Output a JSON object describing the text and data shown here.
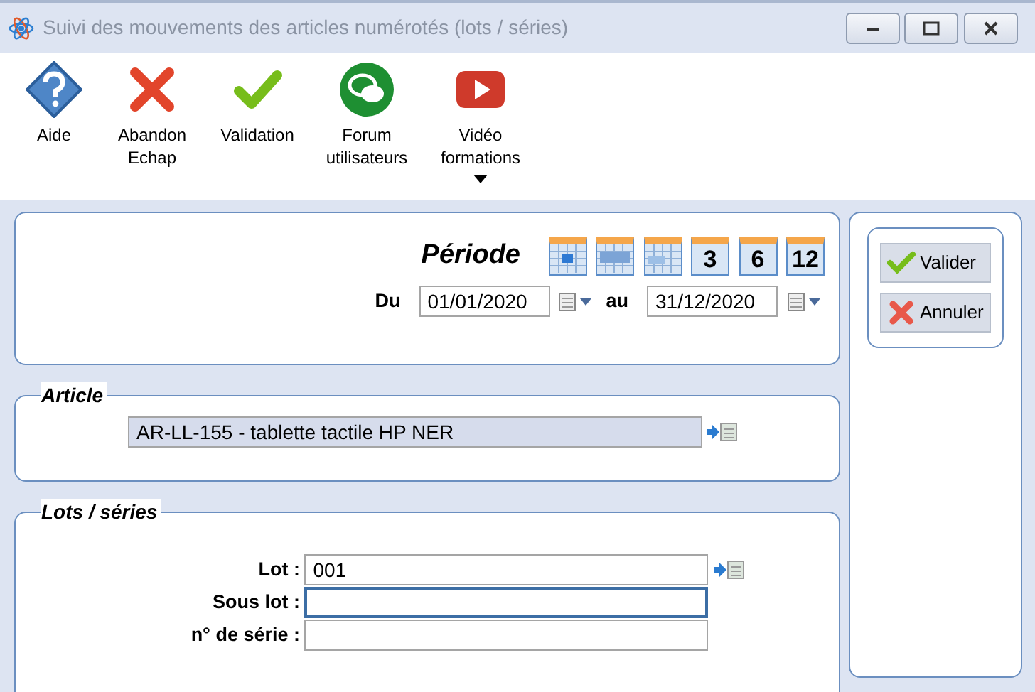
{
  "window": {
    "title": "Suivi des mouvements des articles numérotés (lots / séries)"
  },
  "toolbar": [
    {
      "kind": "help",
      "label": [
        "Aide"
      ],
      "has_menu": false
    },
    {
      "kind": "cancel",
      "label": [
        "Abandon",
        "Echap"
      ],
      "has_menu": false
    },
    {
      "kind": "ok",
      "label": [
        "Validation"
      ],
      "has_menu": false
    },
    {
      "kind": "forum",
      "label": [
        "Forum",
        "utilisateurs"
      ],
      "has_menu": false
    },
    {
      "kind": "video",
      "label": [
        "Vidéo",
        "formations"
      ],
      "has_menu": true
    }
  ],
  "period": {
    "title": "Période",
    "presets": [
      {
        "kind": "day"
      },
      {
        "kind": "week"
      },
      {
        "kind": "month"
      },
      {
        "kind": "number",
        "label": "3"
      },
      {
        "kind": "number",
        "label": "6"
      },
      {
        "kind": "number",
        "label": "12"
      }
    ],
    "from_label": "Du",
    "from": "01/01/2020",
    "to_label": "au",
    "to": "31/12/2020"
  },
  "article": {
    "legend": "Article",
    "value": "AR-LL-155 - tablette tactile HP NER"
  },
  "lots": {
    "legend": "Lots / séries",
    "fields": [
      {
        "label": "Lot :",
        "value": "001",
        "focused": false,
        "lookup": true
      },
      {
        "label": "Sous lot :",
        "focused": true,
        "lookup": false
      },
      {
        "label": "n° de série :",
        "focused": false,
        "lookup": false
      }
    ]
  },
  "actions": [
    {
      "kind": "ok",
      "label": "Valider"
    },
    {
      "kind": "cancel",
      "label": "Annuler"
    }
  ]
}
